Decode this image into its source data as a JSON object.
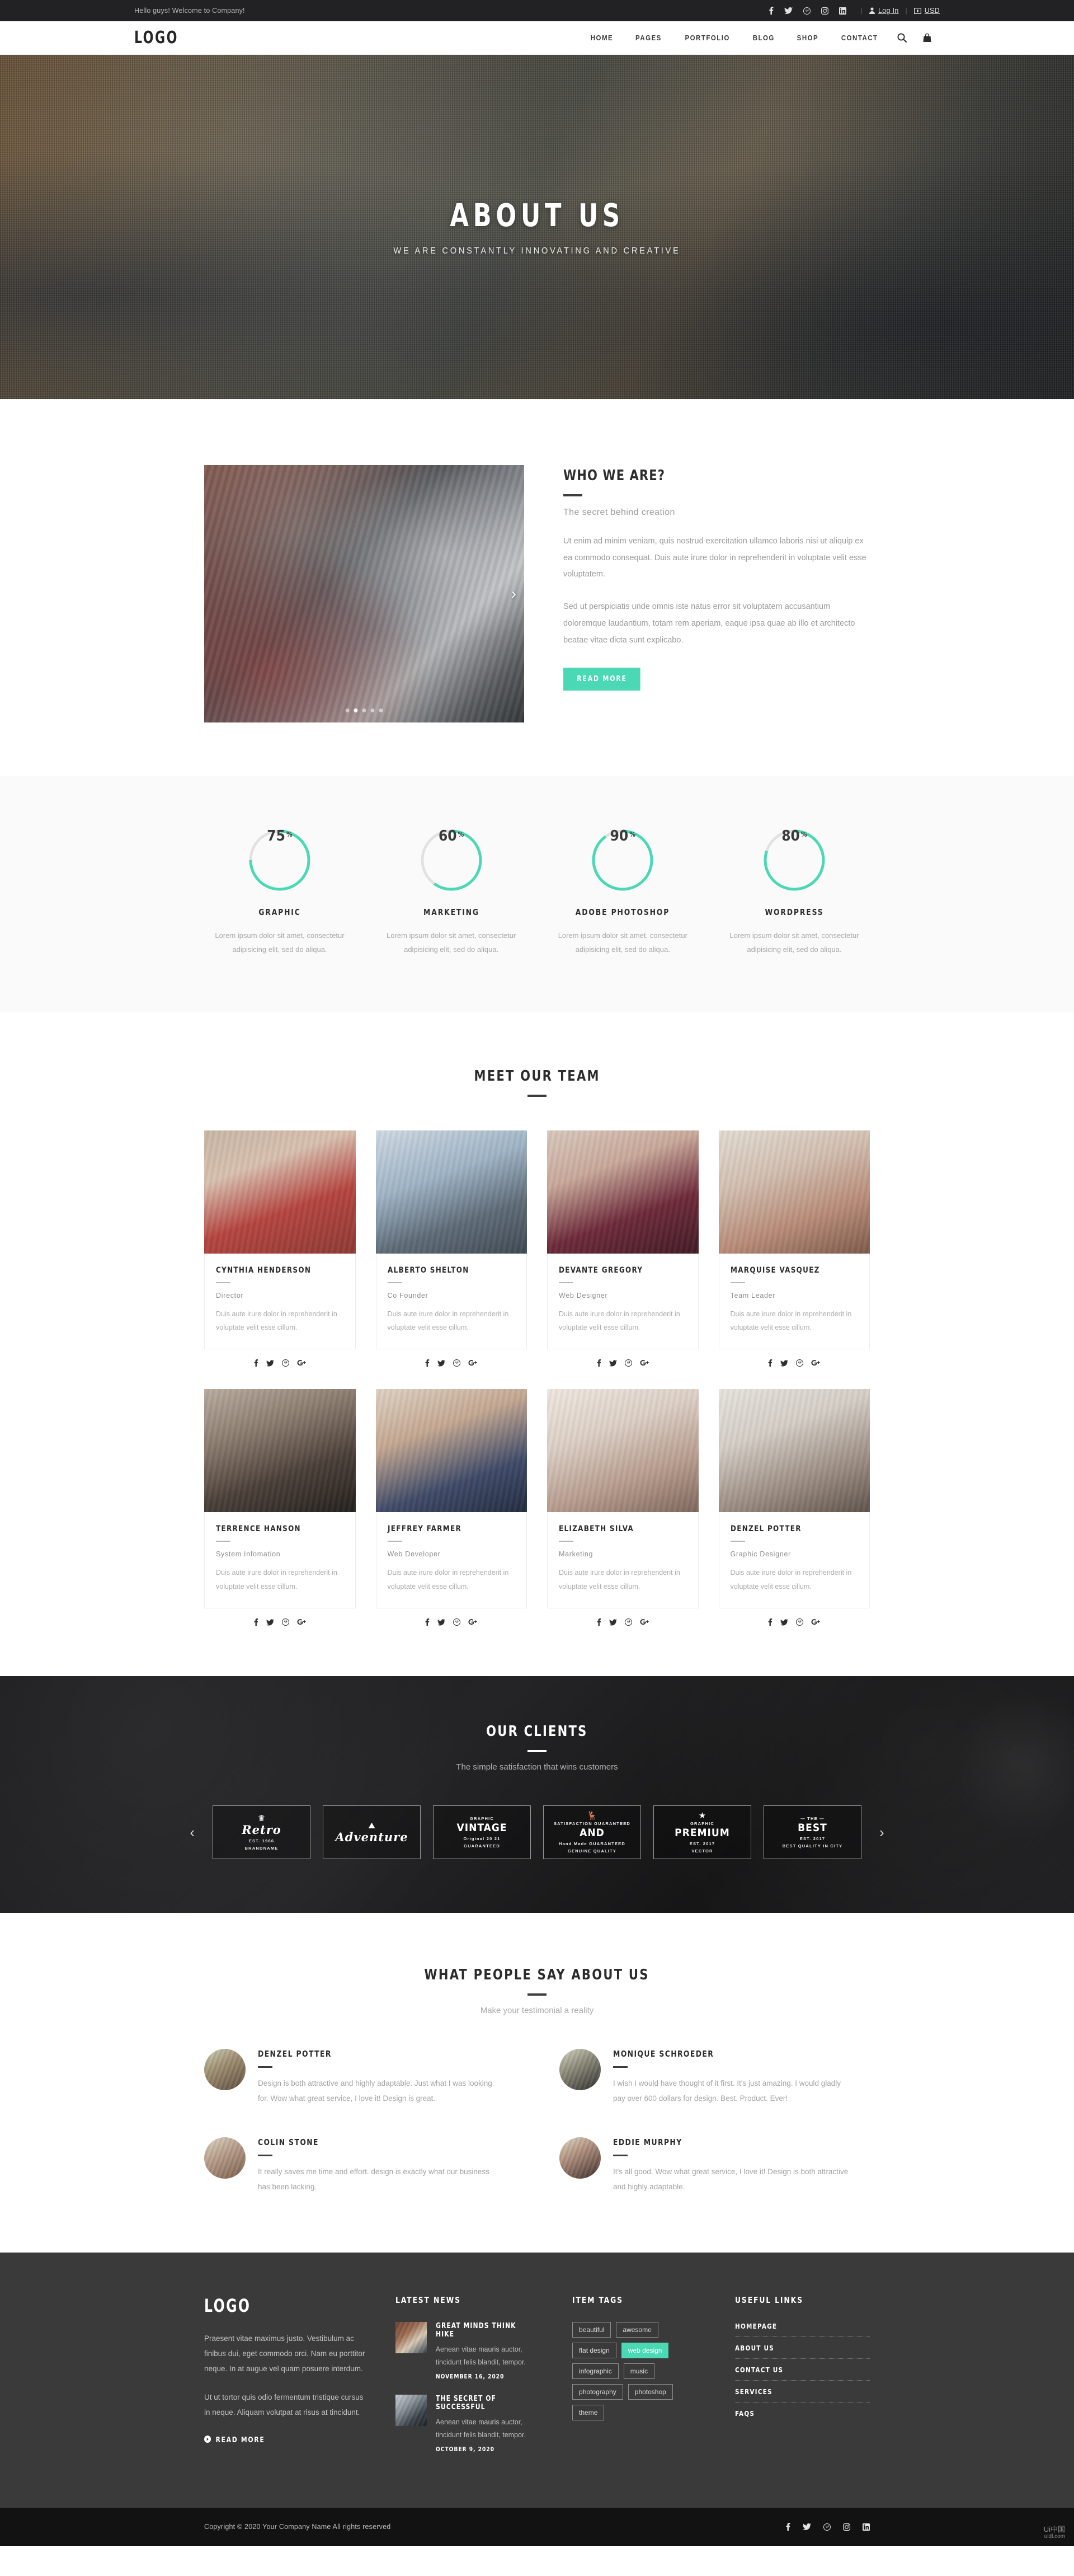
{
  "topbar": {
    "greeting": "Hello guys! Welcome to Company!",
    "socials": [
      "facebook-icon",
      "twitter-icon",
      "pinterest-icon",
      "instagram-icon",
      "linkedin-icon"
    ],
    "login_label": "Log In",
    "currency_label": "USD",
    "separator": "|"
  },
  "header": {
    "logo": "LOGO",
    "nav": [
      {
        "label": "HOME"
      },
      {
        "label": "PAGES"
      },
      {
        "label": "PORTFOLIO"
      },
      {
        "label": "BLOG"
      },
      {
        "label": "SHOP"
      },
      {
        "label": "CONTACT"
      }
    ],
    "search_icon": "search-icon",
    "cart_icon": "shopping-bag-icon"
  },
  "hero": {
    "title": "ABOUT US",
    "subtitle": "WE ARE CONSTANTLY INNOVATING AND CREATIVE"
  },
  "about": {
    "title": "WHO WE ARE?",
    "subtitle": "The secret behind creation",
    "paragraph1": "Ut enim ad minim veniam, quis nostrud exercitation ullamco laboris nisi ut aliquip ex ea commodo consequat. Duis aute irure dolor in reprehenderit in voluptate velit esse voluptatem.",
    "paragraph2": "Sed ut perspiciatis unde omnis iste natus error sit voluptatem accusantium doloremque laudantium, totam rem aperiam, eaque ipsa quae ab illo et architecto beatae vitae dicta sunt explicabo.",
    "button": "READ MORE",
    "slider": {
      "dots": 5,
      "active_dot": 1,
      "next_arrow": "chevron-right-icon"
    }
  },
  "chart_data": {
    "type": "pie",
    "title": "Skills",
    "series": [
      {
        "name": "GRAPHIC",
        "value": 75,
        "unit": "%",
        "color": "#4ad9b4",
        "track": "#e2e2e2",
        "desc": "Lorem ipsum dolor sit amet, consectetur adipisicing elit, sed do aliqua."
      },
      {
        "name": "MARKETING",
        "value": 60,
        "unit": "%",
        "color": "#4ad9b4",
        "track": "#e2e2e2",
        "desc": "Lorem ipsum dolor sit amet, consectetur adipisicing elit, sed do aliqua."
      },
      {
        "name": "ADOBE PHOTOSHOP",
        "value": 90,
        "unit": "%",
        "color": "#4ad9b4",
        "track": "#e2e2e2",
        "desc": "Lorem ipsum dolor sit amet, consectetur adipisicing elit, sed do aliqua."
      },
      {
        "name": "WORDPRESS",
        "value": 80,
        "unit": "%",
        "color": "#4ad9b4",
        "track": "#e2e2e2",
        "desc": "Lorem ipsum dolor sit amet, consectetur adipisicing elit, sed do aliqua."
      }
    ],
    "ylim": [
      0,
      100
    ]
  },
  "team": {
    "heading": "MEET OUR TEAM",
    "socials": [
      "facebook-icon",
      "twitter-icon",
      "pinterest-icon",
      "google-plus-icon"
    ],
    "members": [
      {
        "name": "CYNTHIA HENDERSON",
        "role": "Director",
        "desc": "Duis aute irure dolor in reprehenderit in voluptate velit esse cillum."
      },
      {
        "name": "ALBERTO SHELTON",
        "role": "Co Founder",
        "desc": "Duis aute irure dolor in reprehenderit in voluptate velit esse cillum."
      },
      {
        "name": "DEVANTE GREGORY",
        "role": "Web Designer",
        "desc": "Duis aute irure dolor in reprehenderit in voluptate velit esse cillum."
      },
      {
        "name": "MARQUISE VASQUEZ",
        "role": "Team Leader",
        "desc": "Duis aute irure dolor in reprehenderit in voluptate velit esse cillum."
      },
      {
        "name": "TERRENCE HANSON",
        "role": "System Infomation",
        "desc": "Duis aute irure dolor in reprehenderit in voluptate velit esse cillum."
      },
      {
        "name": "JEFFREY FARMER",
        "role": "Web Developer",
        "desc": "Duis aute irure dolor in reprehenderit in voluptate velit esse cillum."
      },
      {
        "name": "ELIZABETH SILVA",
        "role": "Marketing",
        "desc": "Duis aute irure dolor in reprehenderit in voluptate velit esse cillum."
      },
      {
        "name": "DENZEL POTTER",
        "role": "Graphic Designer",
        "desc": "Duis aute irure dolor in reprehenderit in voluptate velit esse cillum."
      }
    ]
  },
  "clients": {
    "heading": "OUR CLIENTS",
    "subheading": "The simple satisfaction that wins customers",
    "prev_arrow": "chevron-left-icon",
    "next_arrow": "chevron-right-icon",
    "logos": [
      {
        "top": "",
        "main": "Retro",
        "bottom": "BRANDNAME",
        "sub": "EST. 1966",
        "glyph": "♛",
        "script": true
      },
      {
        "top": "",
        "main": "Adventure",
        "bottom": "",
        "sub": "",
        "glyph": "⛰",
        "script": true
      },
      {
        "top": "GRAPHIC",
        "main": "VINTAGE",
        "bottom": "GUARANTEED",
        "sub": "Original 20 21",
        "glyph": "",
        "script": false
      },
      {
        "top": "SATISFACTION GUARANTEED",
        "main": "AND",
        "bottom": "GENUINE QUALITY",
        "sub": "Hand Made GUARANTEED",
        "glyph": "🦌",
        "script": false
      },
      {
        "top": "GRAPHIC",
        "main": "PREMIUM",
        "bottom": "VECTOR",
        "sub": "EST. 2017",
        "glyph": "★",
        "script": false
      },
      {
        "top": "— THE —",
        "main": "BEST",
        "bottom": "BEST QUALITY IN CITY",
        "sub": "EST. 2017",
        "glyph": "",
        "script": false
      }
    ]
  },
  "testimonials": {
    "heading": "WHAT PEOPLE SAY ABOUT US",
    "subheading": "Make your testimonial a reality",
    "items": [
      {
        "name": "DENZEL POTTER",
        "text": "Design is both attractive and highly adaptable. Just what I was looking for. Wow what great service, I love it! Design is great."
      },
      {
        "name": "MONIQUE SCHROEDER",
        "text": "I wish I would have thought of it first. It's just amazing. I would gladly pay over 600 dollars for design. Best. Product. Ever!"
      },
      {
        "name": "COLIN STONE",
        "text": "It really saves me time and effort. design is exactly what our business has been lacking."
      },
      {
        "name": "EDDIE MURPHY",
        "text": "It's all good. Wow what great service, I love it! Design is both attractive and highly adaptable."
      }
    ]
  },
  "footer": {
    "logo": "LOGO",
    "about_p1": "Praesent vitae maximus justo. Vestibulum ac finibus dui, eget commodo orci. Nam eu porttitor neque. In at augue vel quam posuere interdum.",
    "about_p2": "Ut ut tortor quis odio fermentum tristique cursus in neque. Aliquam volutpat at risus at tincidunt.",
    "read_more": "READ MORE",
    "news_heading": "LATEST NEWS",
    "news": [
      {
        "title": "GREAT MINDS THINK HIKE",
        "desc": "Aenean vitae mauris auctor, tincidunt felis blandit, tempor.",
        "date": "NOVEMBER 16, 2020"
      },
      {
        "title": "THE SECRET OF SUCCESSFUL",
        "desc": "Aenean vitae mauris auctor, tincidunt felis blandit, tempor.",
        "date": "OCTOBER 9, 2020"
      }
    ],
    "tags_heading": "ITEM TAGS",
    "tags": [
      {
        "label": "beautiful",
        "active": false
      },
      {
        "label": "awesome",
        "active": false
      },
      {
        "label": "flat design",
        "active": false
      },
      {
        "label": "web design",
        "active": true
      },
      {
        "label": "infographic",
        "active": false
      },
      {
        "label": "music",
        "active": false
      },
      {
        "label": "photography",
        "active": false
      },
      {
        "label": "photoshop",
        "active": false
      },
      {
        "label": "theme",
        "active": false
      }
    ],
    "links_heading": "USEFUL LINKS",
    "links": [
      "HOMEPAGE",
      "ABOUT US",
      "CONTACT US",
      "SERVICES",
      "FAQS"
    ]
  },
  "copyright": {
    "text": "Copyright © 2020 Your Company Name All rights reserved",
    "socials": [
      "facebook-icon",
      "twitter-icon",
      "pinterest-icon",
      "instagram-icon",
      "linkedin-icon"
    ]
  },
  "watermark": {
    "line1": "Ui中国",
    "line2": "uidl.com"
  },
  "colors": {
    "accent": "#4ad9b4",
    "dark": "#222224",
    "footer": "#3a3a3a",
    "copybar": "#121212"
  }
}
